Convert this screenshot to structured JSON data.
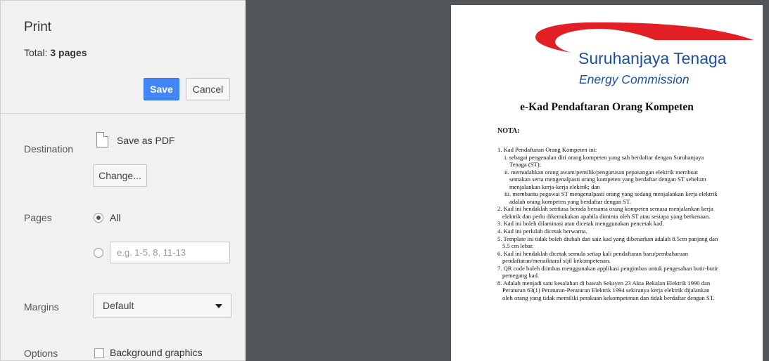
{
  "print_panel": {
    "title": "Print",
    "total_label": "Total: ",
    "total_value": "3 pages",
    "save_label": "Save",
    "cancel_label": "Cancel",
    "destination": {
      "label": "Destination",
      "value": "Save as PDF",
      "icon": "pdf-file-icon",
      "change_label": "Change..."
    },
    "pages": {
      "label": "Pages",
      "all_label": "All",
      "selected": "All",
      "range_placeholder": "e.g. 1-5, 8, 11-13"
    },
    "margins": {
      "label": "Margins",
      "value": "Default"
    },
    "options": {
      "label": "Options",
      "background_graphics_label": "Background graphics",
      "background_graphics_checked": false
    }
  },
  "colors": {
    "sidebar_bg": "#f1f1f1",
    "save_button": "#4285f4",
    "preview_bg": "#525659",
    "logo_red": "#e31f26",
    "logo_blue": "#1d4fa3"
  },
  "preview": {
    "logo": {
      "line1": "Suruhanjaya Tenaga",
      "line2": "Energy Commission"
    },
    "title": "e-Kad Pendaftaran Orang Kompeten",
    "nota_label": "NOTA:",
    "notes": [
      "1. Kad Pendaftaran Orang Kompeten ini:",
      "i. sebagai pengenalan diri orang kompeten yang sah berdaftar dengan Suruhanjaya",
      "Tenaga (ST);",
      "ii. memudahkan orang awam/pemilik/pengurusan pepasangan elektrik membuat",
      "semakan serta mengenalpasti orang kompeten yang berdaftar dengan ST sebelum",
      "menjalankan kerja-kerja elektrik; dan",
      "iii. membantu pegawai ST mengenalpasti orang yang sedang menjalankan kerja elektrik",
      "adalah orang kompeten yang berdaftar dengan ST.",
      "2. Kad ini hendaklah sentiasa berada bersama orang kompeten semasa menjalankan kerja",
      "elektrik dan perlu dikemukakan apabila diminta oleh ST atau sesiapa yang berkenaan.",
      "3. Kad ini boleh dilaminasi atau dicetak menggunakan pencetak kad.",
      "4. Kad ini perlulah dicetak berwarna.",
      "5. Template ini tidak boleh diubah dan saiz kad yang dibenarkan adalah 8.5cm panjang dan",
      "5.5 cm lebar.",
      "6. Kad ini hendaklah dicetak semula setiap kali pendaftaran baru/pembaharuan",
      "pendaftaran/menaiktaraf sijil kekompetenan.",
      "7. QR code boleh diimbas menggunakan applikasi pengimbas untuk pengesahan butir-butir",
      "pemegang kad.",
      "8. Adalah menjadi satu kesalahan di bawah Seksyen 23 Akta Bekalan Elektrik 1990 dan",
      "Peraturan 63(1) Peraturan-Peraturan Elektrik 1994 sekiranya kerja elektrik dijalankan",
      "oleh orang yang tidak memiliki perakuan kekompetenan dan tidak berdaftar dengan ST."
    ]
  }
}
